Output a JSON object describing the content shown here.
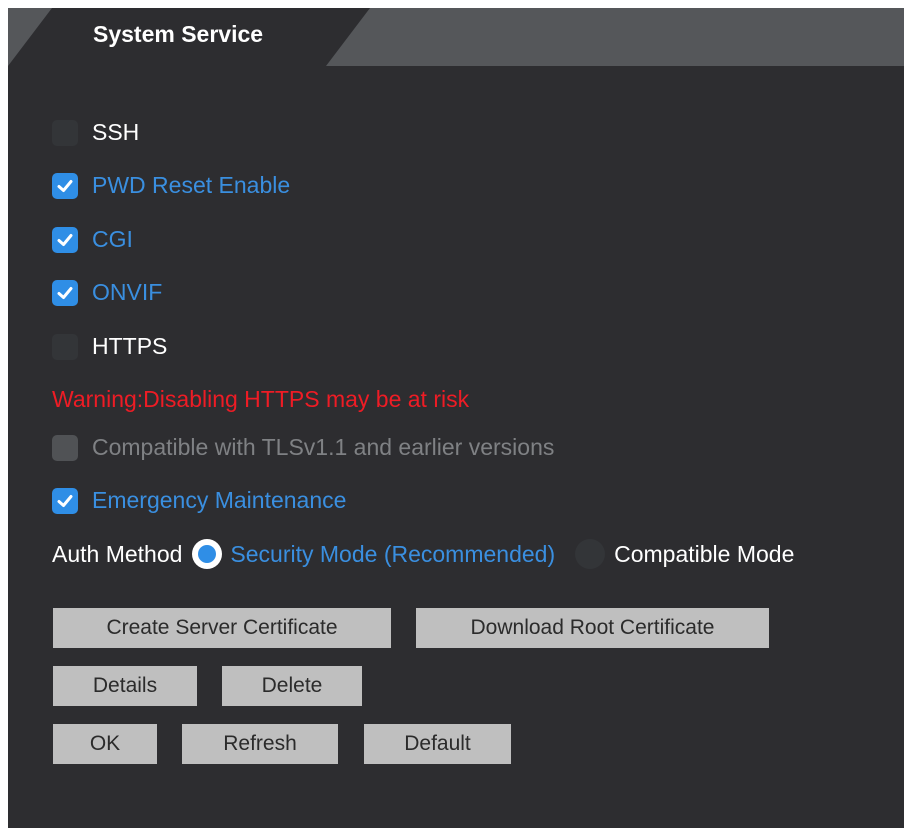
{
  "tab": {
    "label": "System Service"
  },
  "options": {
    "ssh": {
      "label": "SSH",
      "checked": false
    },
    "pwd_reset": {
      "label": "PWD Reset Enable",
      "checked": true
    },
    "cgi": {
      "label": "CGI",
      "checked": true
    },
    "onvif": {
      "label": "ONVIF",
      "checked": true
    },
    "https": {
      "label": "HTTPS",
      "checked": false
    },
    "tls": {
      "label": "Compatible with TLSv1.1 and earlier versions",
      "checked": false,
      "disabled": true
    },
    "emergency": {
      "label": "Emergency Maintenance",
      "checked": true
    }
  },
  "warning": "Warning:Disabling HTTPS may be at risk",
  "auth": {
    "label": "Auth Method",
    "security_mode": "Security Mode (Recommended)",
    "compatible_mode": "Compatible Mode",
    "selected": "security_mode"
  },
  "buttons": {
    "create_cert": "Create Server Certificate",
    "download_root": "Download Root Certificate",
    "details": "Details",
    "delete": "Delete",
    "ok": "OK",
    "refresh": "Refresh",
    "default": "Default"
  },
  "colors": {
    "background": "#2d2d30",
    "accent_blue": "#2f8ee6",
    "warning_red": "#ee1c25",
    "button_gray": "#bfbfbf"
  },
  "icons": {
    "checkbox_checked": "checkmark-icon",
    "radio_selected": "radio-dot-icon"
  }
}
